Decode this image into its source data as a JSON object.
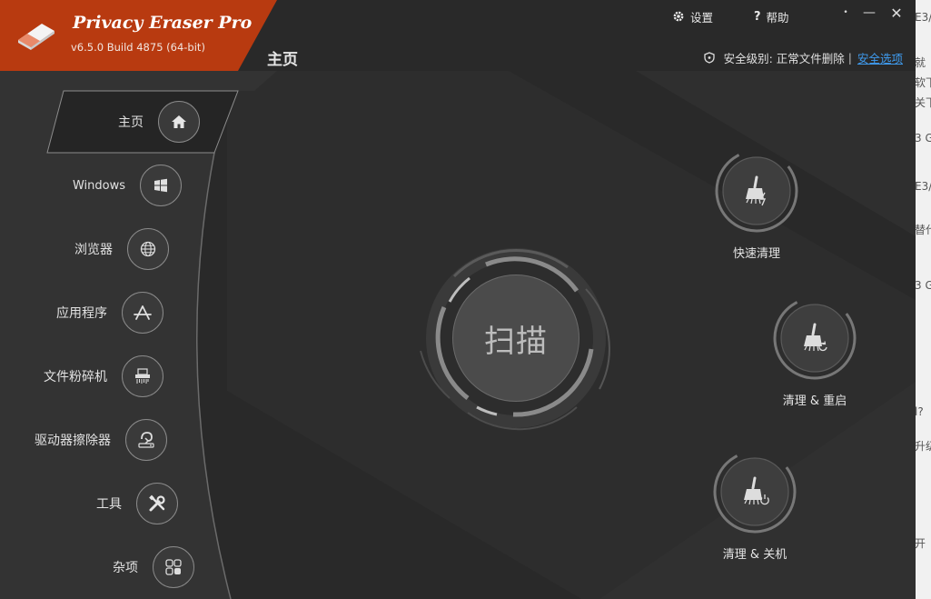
{
  "app": {
    "name": "Privacy Eraser Pro",
    "version": "v6.5.0 Build 4875 (64-bit)"
  },
  "toolbar": {
    "settings_label": "设置",
    "help_label": "帮助"
  },
  "header": {
    "page_title": "主页",
    "security_label": "安全级别: 正常文件删除",
    "security_sep": "|",
    "security_link": "安全选项"
  },
  "nav": {
    "items": [
      {
        "label": "主页",
        "icon": "home-icon"
      },
      {
        "label": "Windows",
        "icon": "windows-icon"
      },
      {
        "label": "浏览器",
        "icon": "globe-icon"
      },
      {
        "label": "应用程序",
        "icon": "app-store-icon"
      },
      {
        "label": "文件粉碎机",
        "icon": "shredder-icon"
      },
      {
        "label": "驱动器擦除器",
        "icon": "drive-wiper-icon"
      },
      {
        "label": "工具",
        "icon": "tools-icon"
      },
      {
        "label": "杂项",
        "icon": "grid-icon"
      }
    ]
  },
  "main": {
    "scan_label": "扫描",
    "actions": [
      {
        "label": "快速清理",
        "icon": "broom-lightning-icon"
      },
      {
        "label": "清理 & 重启",
        "icon": "broom-restart-icon"
      },
      {
        "label": "清理 & 关机",
        "icon": "broom-power-icon"
      }
    ]
  },
  "colors": {
    "logo_bg": "#b83a10",
    "window_bg": "#2b2b2b",
    "link": "#3f9cf0"
  },
  "background_text": [
    "E3/",
    "就",
    "软下",
    "关下",
    "3 G",
    "E3/",
    "替代",
    "3 G",
    "l?",
    "升级",
    "开"
  ]
}
